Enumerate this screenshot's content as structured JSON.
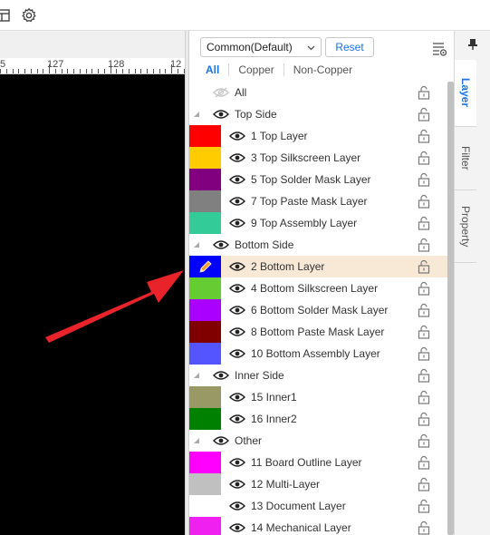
{
  "toolbar": {
    "icons": [
      "layout-icon",
      "gear-icon"
    ]
  },
  "ruler": {
    "labels": [
      "5",
      "127",
      "128",
      "12"
    ]
  },
  "panel": {
    "preset_value": "Common(Default)",
    "reset_label": "Reset",
    "filter_tabs": [
      "All",
      "Copper",
      "Non-Copper"
    ],
    "active_filter": "All",
    "rows": [
      {
        "type": "all",
        "label": "All"
      },
      {
        "type": "group",
        "label": "Top Side"
      },
      {
        "type": "layer",
        "label": "1 Top Layer",
        "color": "#ff0000"
      },
      {
        "type": "layer",
        "label": "3 Top Silkscreen Layer",
        "color": "#ffcc00"
      },
      {
        "type": "layer",
        "label": "5 Top Solder Mask Layer",
        "color": "#800080"
      },
      {
        "type": "layer",
        "label": "7 Top Paste Mask Layer",
        "color": "#808080"
      },
      {
        "type": "layer",
        "label": "9 Top Assembly Layer",
        "color": "#33cc99"
      },
      {
        "type": "group",
        "label": "Bottom Side"
      },
      {
        "type": "layer",
        "label": "2 Bottom Layer",
        "color": "#0000ff",
        "selected": true
      },
      {
        "type": "layer",
        "label": "4 Bottom Silkscreen Layer",
        "color": "#66cc33"
      },
      {
        "type": "layer",
        "label": "6 Bottom Solder Mask Layer",
        "color": "#aa00ff"
      },
      {
        "type": "layer",
        "label": "8 Bottom Paste Mask Layer",
        "color": "#800000"
      },
      {
        "type": "layer",
        "label": "10 Bottom Assembly Layer",
        "color": "#5555ff"
      },
      {
        "type": "group",
        "label": "Inner Side"
      },
      {
        "type": "layer",
        "label": "15 Inner1",
        "color": "#999966"
      },
      {
        "type": "layer",
        "label": "16 Inner2",
        "color": "#008000"
      },
      {
        "type": "group",
        "label": "Other"
      },
      {
        "type": "layer",
        "label": "11 Board Outline Layer",
        "color": "#ff00ff"
      },
      {
        "type": "layer",
        "label": "12 Multi-Layer",
        "color": "#c0c0c0"
      },
      {
        "type": "layer",
        "label": "13 Document Layer",
        "color": "#ffffff"
      },
      {
        "type": "layer",
        "label": "14 Mechanical Layer",
        "color": "#f020f0"
      }
    ]
  },
  "side_tabs": [
    {
      "label": "Layer",
      "active": true
    },
    {
      "label": "Filter",
      "active": false
    },
    {
      "label": "Property",
      "active": false
    }
  ],
  "accent_color": "#1a73e8",
  "arrow_color": "#e8232a"
}
